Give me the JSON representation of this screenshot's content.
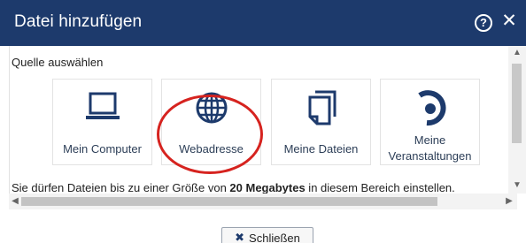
{
  "dialog": {
    "title": "Datei hinzufügen",
    "help_icon": "help-circle-icon",
    "close_icon": "close-icon"
  },
  "source": {
    "label": "Quelle auswählen",
    "tiles": [
      {
        "label": "Mein Computer",
        "icon": "laptop-icon"
      },
      {
        "label": "Webadresse",
        "icon": "globe-icon"
      },
      {
        "label": "Meine Dateien",
        "icon": "documents-icon"
      },
      {
        "label_line1": "Meine",
        "label_line2": "Veranstaltungen",
        "icon": "courses-icon"
      }
    ]
  },
  "info": {
    "prefix": "Sie dürfen Dateien bis zu einer Größe von ",
    "size": "20 Megabytes",
    "suffix": " in diesem Bereich einstellen."
  },
  "footer": {
    "close_label": "Schließen"
  },
  "colors": {
    "titlebar": "#1d3a6c",
    "icon": "#1d3a6c",
    "annotation": "#d6231f"
  }
}
